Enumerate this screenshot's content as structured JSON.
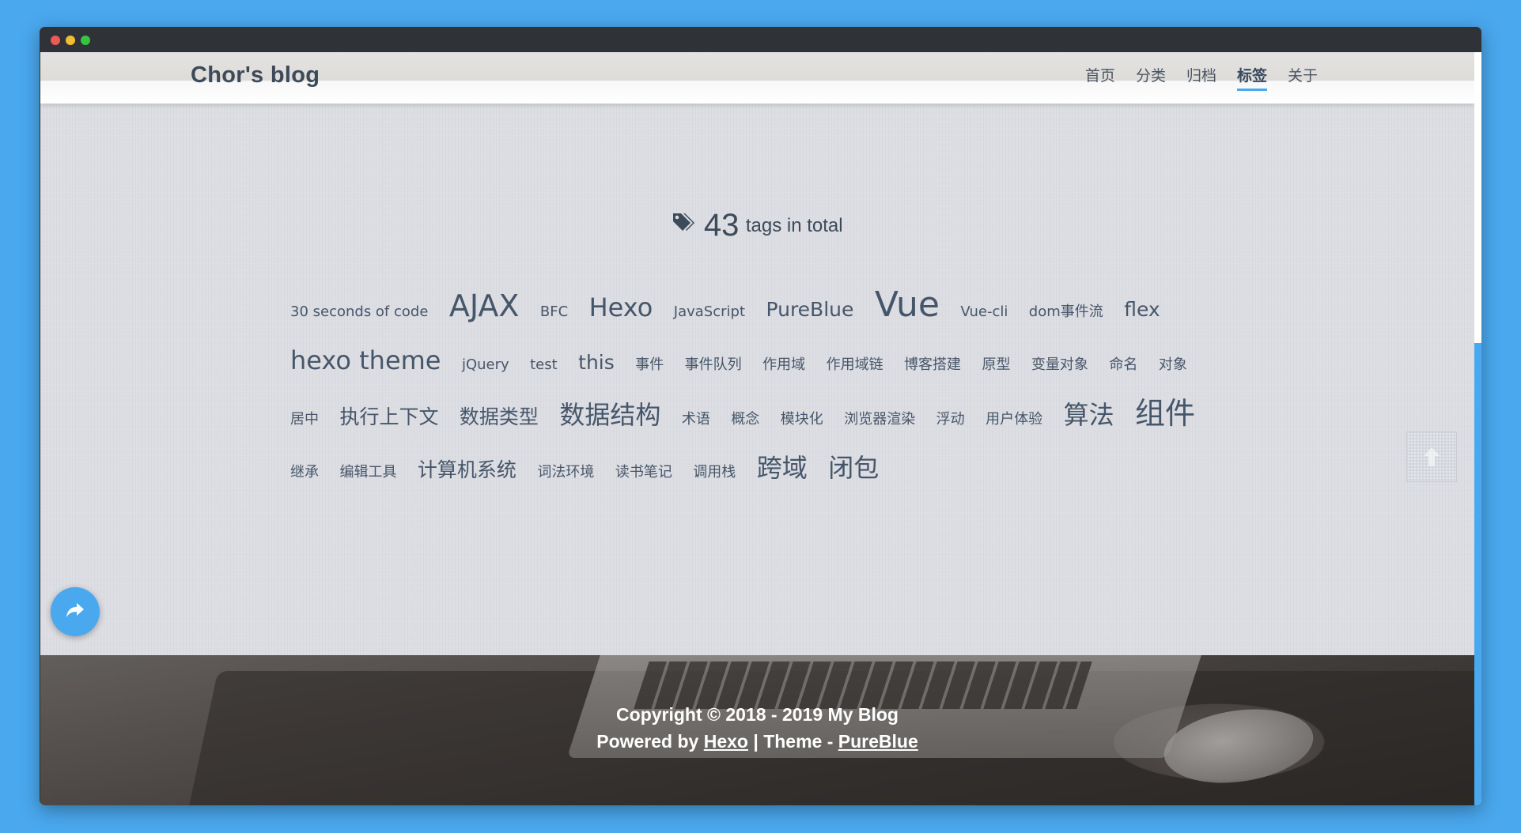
{
  "header": {
    "brand": "Chor's blog",
    "nav": [
      {
        "label": "首页",
        "active": false
      },
      {
        "label": "分类",
        "active": false
      },
      {
        "label": "归档",
        "active": false
      },
      {
        "label": "标签",
        "active": true
      },
      {
        "label": "关于",
        "active": false
      }
    ]
  },
  "tags_page": {
    "count": "43",
    "label": "tags in total",
    "icon": "tags-icon",
    "tags": [
      {
        "name": "30 seconds of code",
        "size": 18
      },
      {
        "name": "AJAX",
        "size": 38
      },
      {
        "name": "BFC",
        "size": 18
      },
      {
        "name": "Hexo",
        "size": 32
      },
      {
        "name": "JavaScript",
        "size": 18
      },
      {
        "name": "PureBlue",
        "size": 25
      },
      {
        "name": "Vue",
        "size": 44
      },
      {
        "name": "Vue-cli",
        "size": 18
      },
      {
        "name": "dom事件流",
        "size": 18
      },
      {
        "name": "flex",
        "size": 25
      },
      {
        "name": "hexo theme",
        "size": 32
      },
      {
        "name": "jQuery",
        "size": 18
      },
      {
        "name": "test",
        "size": 18
      },
      {
        "name": "this",
        "size": 25
      },
      {
        "name": "事件",
        "size": 18
      },
      {
        "name": "事件队列",
        "size": 18
      },
      {
        "name": "作用域",
        "size": 18
      },
      {
        "name": "作用域链",
        "size": 18
      },
      {
        "name": "博客搭建",
        "size": 18
      },
      {
        "name": "原型",
        "size": 18
      },
      {
        "name": "变量对象",
        "size": 18
      },
      {
        "name": "命名",
        "size": 18
      },
      {
        "name": "对象",
        "size": 18
      },
      {
        "name": "居中",
        "size": 18
      },
      {
        "name": "执行上下文",
        "size": 25
      },
      {
        "name": "数据类型",
        "size": 25
      },
      {
        "name": "数据结构",
        "size": 32
      },
      {
        "name": "术语",
        "size": 18
      },
      {
        "name": "概念",
        "size": 18
      },
      {
        "name": "模块化",
        "size": 18
      },
      {
        "name": "浏览器渲染",
        "size": 18
      },
      {
        "name": "浮动",
        "size": 18
      },
      {
        "name": "用户体验",
        "size": 18
      },
      {
        "name": "算法",
        "size": 32
      },
      {
        "name": "组件",
        "size": 38
      },
      {
        "name": "继承",
        "size": 18
      },
      {
        "name": "编辑工具",
        "size": 18
      },
      {
        "name": "计算机系统",
        "size": 25
      },
      {
        "name": "词法环境",
        "size": 18
      },
      {
        "name": "读书笔记",
        "size": 18
      },
      {
        "name": "调用栈",
        "size": 18
      },
      {
        "name": "跨域",
        "size": 32
      },
      {
        "name": "闭包",
        "size": 32
      }
    ]
  },
  "footer": {
    "copyright": "Copyright © 2018 - 2019 My Blog",
    "powered_prefix": "Powered by",
    "powered_link": "Hexo",
    "theme_sep": " | Theme - ",
    "theme_link": "PureBlue"
  },
  "icons": {
    "share": "share-icon",
    "back_to_top": "arrow-up-icon"
  },
  "colors": {
    "accent": "#4aa8ee",
    "text": "#3c4a5a",
    "desktop_bg": "#4aa8ee"
  }
}
